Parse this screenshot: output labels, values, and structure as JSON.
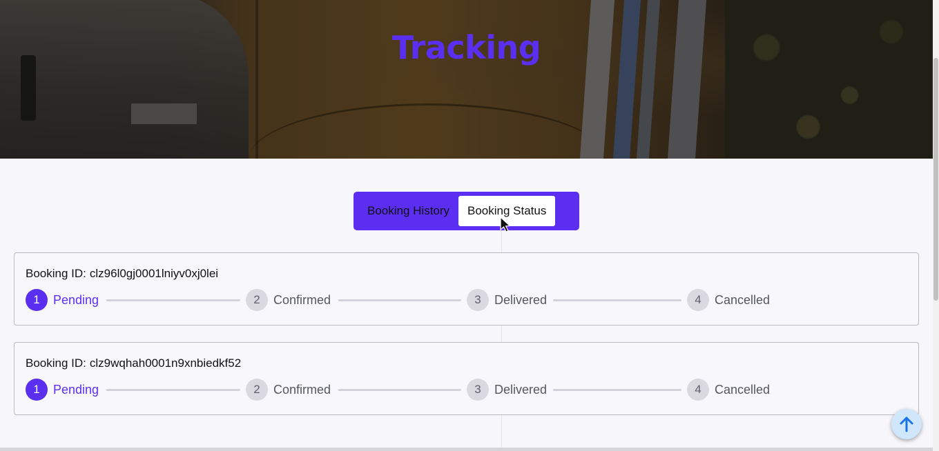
{
  "hero": {
    "title": "Tracking",
    "title_color": "#5b2ff0"
  },
  "tabs": {
    "history_label": "Booking History",
    "status_label": "Booking Status",
    "active": "Booking Status",
    "accent": "#5c2ef2"
  },
  "bookings": [
    {
      "id_label": "Booking ID:",
      "id": "clz96l0gj0001lniyv0xj0lei",
      "current_step": 1,
      "steps": [
        {
          "number": "1",
          "label": "Pending"
        },
        {
          "number": "2",
          "label": "Confirmed"
        },
        {
          "number": "3",
          "label": "Delivered"
        },
        {
          "number": "4",
          "label": "Cancelled"
        }
      ]
    },
    {
      "id_label": "Booking ID:",
      "id": "clz9wqhah0001n9xnbiedkf52",
      "current_step": 1,
      "steps": [
        {
          "number": "1",
          "label": "Pending"
        },
        {
          "number": "2",
          "label": "Confirmed"
        },
        {
          "number": "3",
          "label": "Delivered"
        },
        {
          "number": "4",
          "label": "Cancelled"
        }
      ]
    }
  ],
  "back_to_top": {
    "icon": "arrow-up-icon"
  }
}
